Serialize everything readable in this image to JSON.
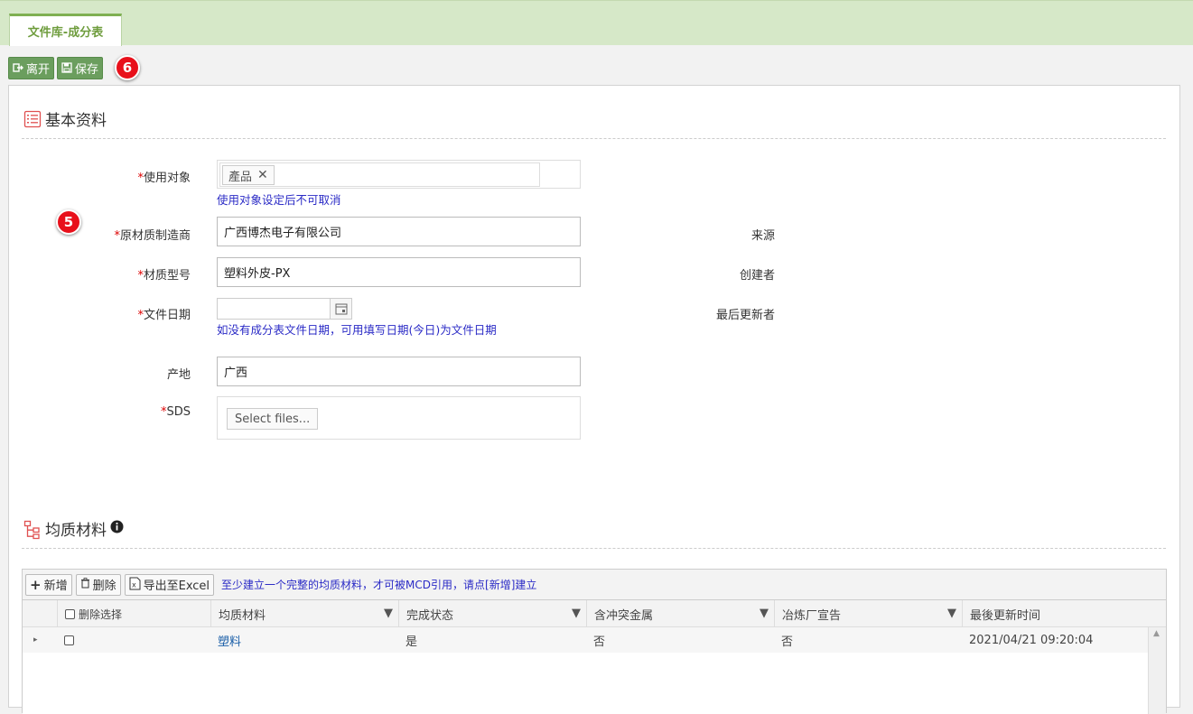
{
  "tab": {
    "title": "文件库-成分表"
  },
  "toolbar": {
    "leave_label": "离开",
    "save_label": "保存",
    "step_badge": "6"
  },
  "basic": {
    "title": "基本资料",
    "step_badge": "5",
    "usage_target": {
      "label": "使用对象",
      "tag": "產品",
      "hint": "使用对象设定后不可取消"
    },
    "manufacturer": {
      "label": "原材质制造商",
      "value": "广西博杰电子有限公司"
    },
    "material_model": {
      "label": "材质型号",
      "value": "塑料外皮-PX"
    },
    "doc_date": {
      "label": "文件日期",
      "value": "",
      "hint": "如没有成分表文件日期，可用填写日期(今日)为文件日期"
    },
    "origin": {
      "label": "产地",
      "value": "广西"
    },
    "sds": {
      "label": "SDS",
      "button": "Select files..."
    },
    "source_label": "来源",
    "creator_label": "创建者",
    "last_updater_label": "最后更新者"
  },
  "homogeneous": {
    "title": "均质材料",
    "toolbar": {
      "add_label": "新增",
      "delete_label": "删除",
      "export_label": "导出至Excel",
      "note": "至少建立一个完整的均质材料，才可被MCD引用，请点[新增]建立"
    },
    "columns": [
      "删除选择",
      "均质材料",
      "完成状态",
      "含冲突金属",
      "冶炼厂宣告",
      "最後更新时间"
    ],
    "rows": [
      {
        "material": "塑料",
        "status": "是",
        "conflict_metal": "否",
        "smelter": "否",
        "updated": "2021/04/21 09:20:04"
      }
    ]
  }
}
